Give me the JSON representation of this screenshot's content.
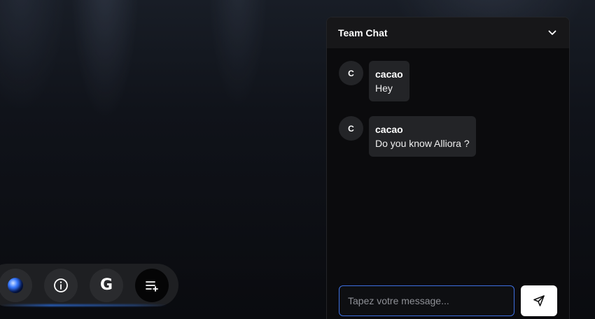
{
  "toolbar": {
    "items": [
      {
        "icon": "globe-icon"
      },
      {
        "icon": "info-icon"
      },
      {
        "icon": "google-icon",
        "glyph": "G"
      },
      {
        "icon": "playlist-add-icon"
      }
    ]
  },
  "chat": {
    "title": "Team Chat",
    "toggle_icon": "chevron-down-icon",
    "messages": [
      {
        "initial": "C",
        "author": "cacao",
        "text": "Hey"
      },
      {
        "initial": "C",
        "author": "cacao",
        "text": "Do you know Alliora ?"
      }
    ],
    "input": {
      "placeholder": "Tapez votre message...",
      "value": ""
    },
    "send_icon": "send-icon"
  },
  "colors": {
    "panel_bg": "#0b0b0d",
    "header_bg": "#171719",
    "bubble_bg": "#232427",
    "input_border": "#3d6fe0",
    "toolbar_bg": "#1e1f22",
    "glow": "#2878ff"
  }
}
